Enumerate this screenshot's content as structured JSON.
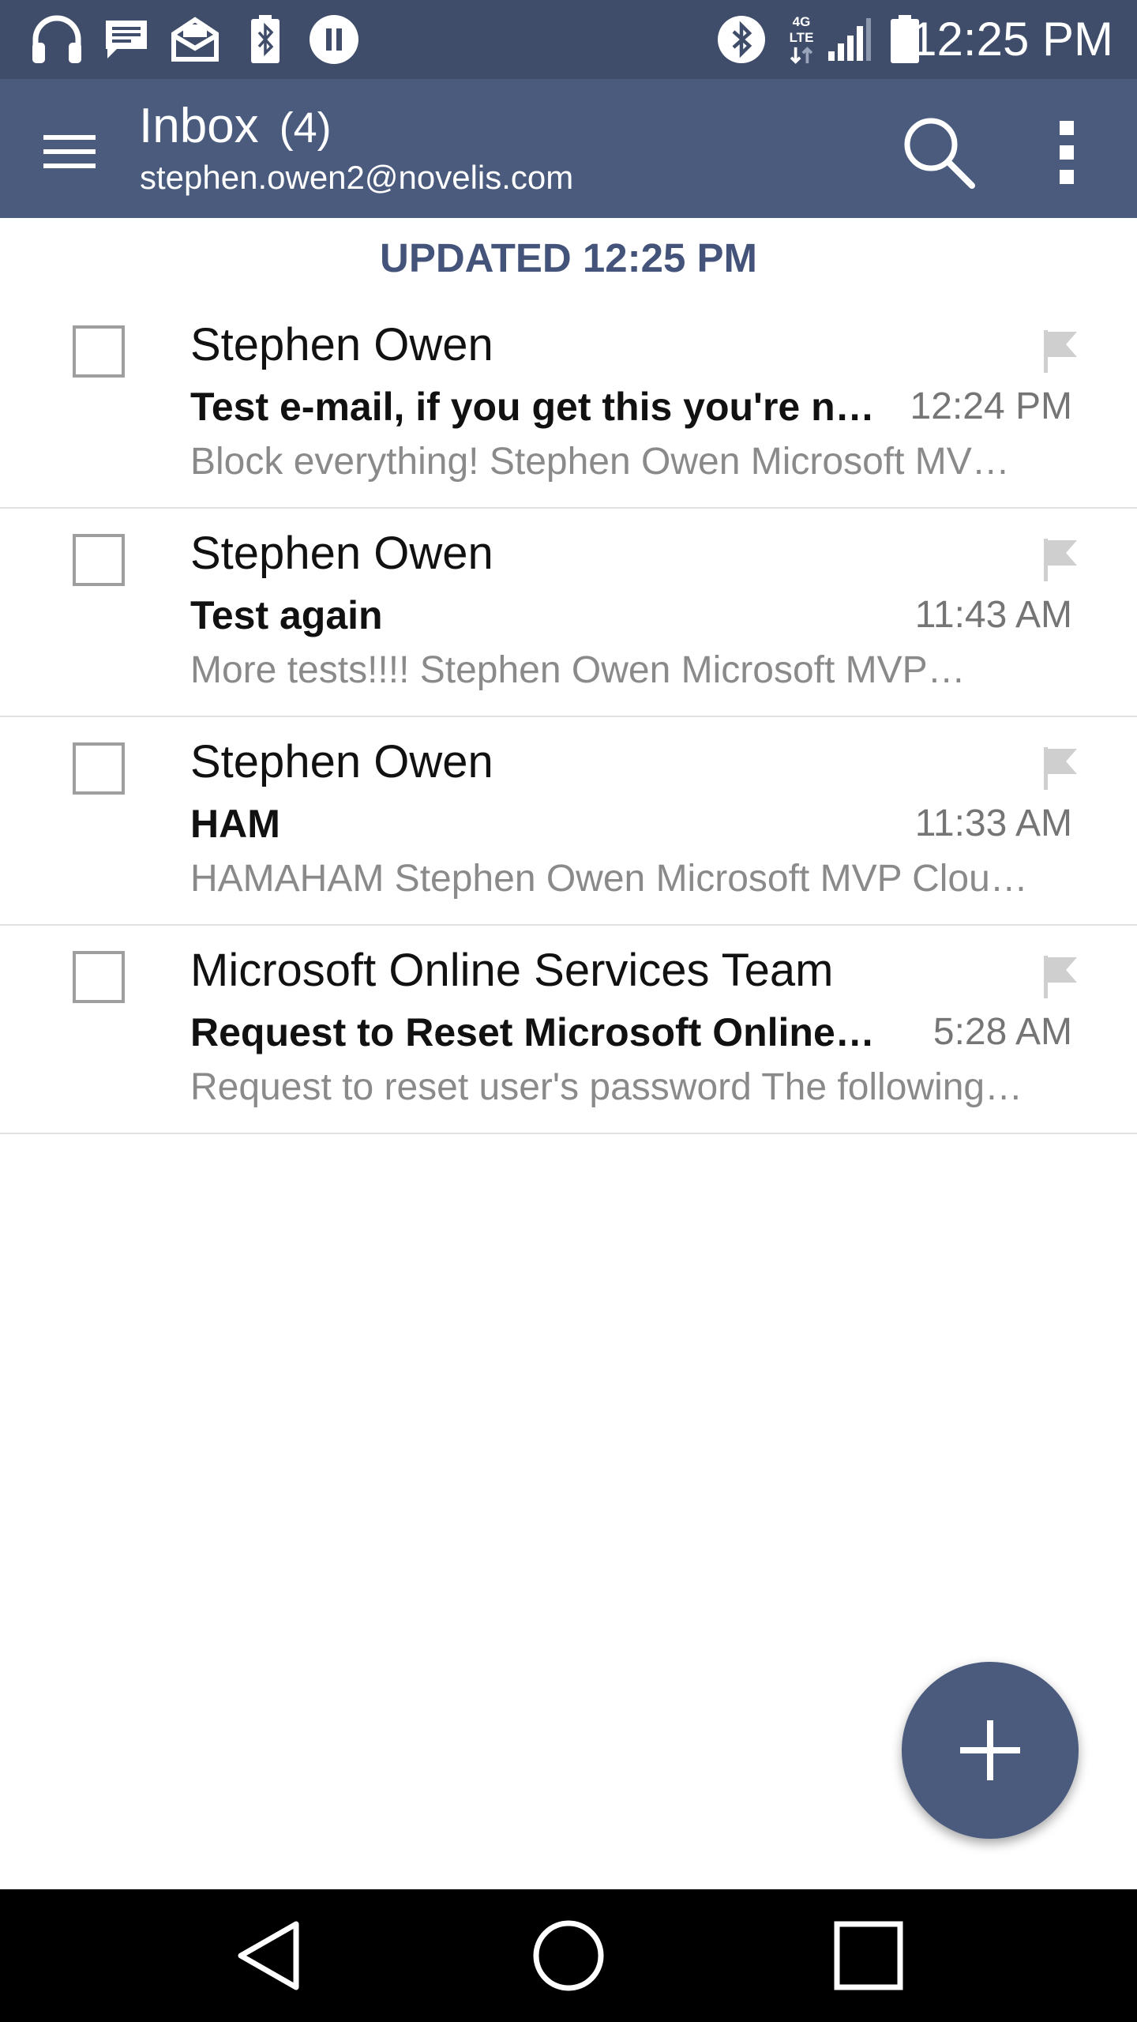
{
  "status_bar": {
    "time": "12:25 PM",
    "network_label": "4G LTE",
    "icons": [
      "headphones-icon",
      "message-icon",
      "mail-icon",
      "bluetooth-battery-icon",
      "media-pause-icon",
      "bluetooth-icon",
      "network-4g-lte-icon",
      "signal-icon",
      "battery-icon"
    ]
  },
  "header": {
    "title": "Inbox",
    "count": "(4)",
    "account": "stephen.owen2@novelis.com",
    "icons": [
      "menu-icon",
      "search-icon",
      "more-vert-icon"
    ]
  },
  "list": {
    "updated_label": "UPDATED 12:25 PM",
    "messages": [
      {
        "sender": "Stephen Owen",
        "subject": "Test e-mail, if you get this you're no…",
        "time": "12:24 PM",
        "preview": "Block everything! Stephen Owen Microsoft MV…"
      },
      {
        "sender": "Stephen Owen",
        "subject": "Test again",
        "time": "11:43 AM",
        "preview": "More tests!!!! Stephen Owen Microsoft MVP…"
      },
      {
        "sender": "Stephen Owen",
        "subject": "HAM",
        "time": "11:33 AM",
        "preview": "HAMAHAM Stephen Owen Microsoft MVP Clou…"
      },
      {
        "sender": "Microsoft Online Services Team",
        "subject": "Request to Reset Microsoft Online S…",
        "time": "5:28 AM",
        "preview": "Request to reset user's password The following…"
      }
    ]
  },
  "fab": {
    "icon": "plus-icon"
  },
  "nav": {
    "icons": [
      "back-icon",
      "home-icon",
      "recents-icon"
    ]
  },
  "colors": {
    "status_bar": "#3f4d6a",
    "app_bar": "#4a5b7e",
    "accent_text": "#44537a",
    "nav_bar": "#000000"
  }
}
